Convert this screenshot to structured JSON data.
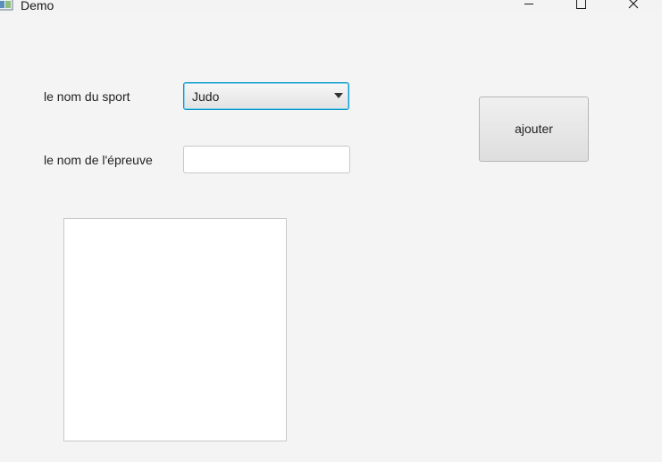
{
  "window": {
    "title": "Demo",
    "icon": "java-app-icon",
    "controls": [
      "minimize-icon",
      "maximize-icon",
      "close-icon"
    ]
  },
  "form": {
    "sport_label": "le nom du sport",
    "sport_selected": "Judo",
    "epreuve_label": "le nom de l'épreuve",
    "epreuve_value": "",
    "epreuve_placeholder": ""
  },
  "actions": {
    "add_label": "ajouter"
  },
  "list": {
    "items": []
  },
  "colors": {
    "focus_border": "#0096c9",
    "background": "#f4f4f4"
  }
}
